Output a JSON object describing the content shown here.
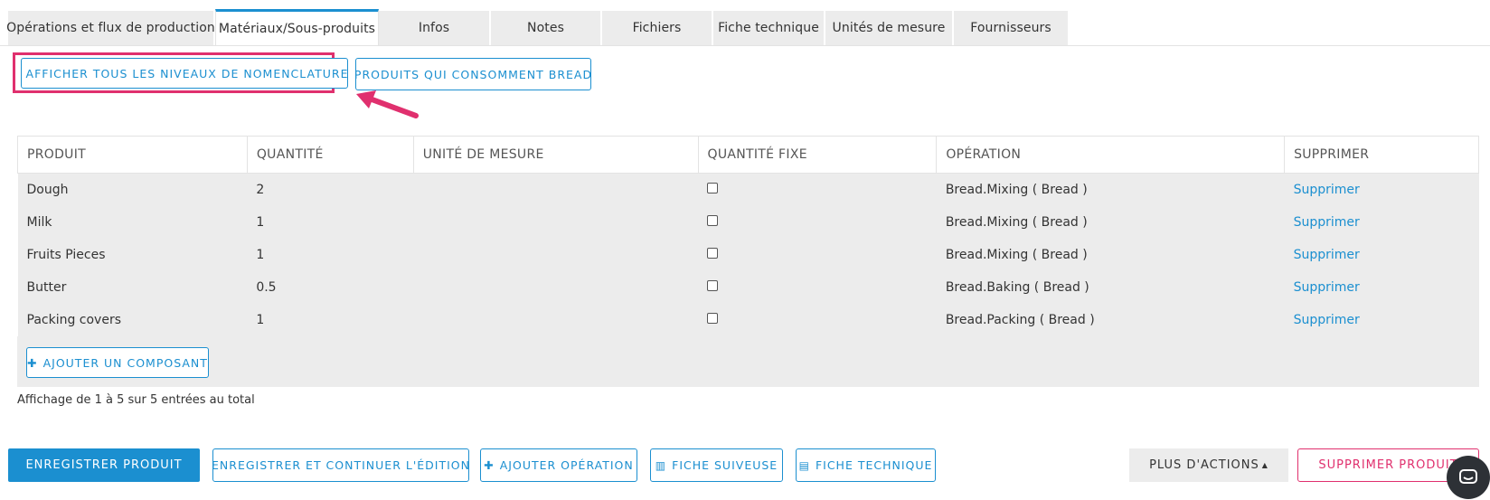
{
  "tabs": [
    {
      "label": "Opérations et flux de production"
    },
    {
      "label": "Matériaux/Sous-produits"
    },
    {
      "label": "Infos"
    },
    {
      "label": "Notes"
    },
    {
      "label": "Fichiers"
    },
    {
      "label": "Fiche technique"
    },
    {
      "label": "Unités de mesure"
    },
    {
      "label": "Fournisseurs"
    }
  ],
  "toolbar": {
    "show_bom_levels": "AFFICHER TOUS LES NIVEAUX DE NOMENCLATURE",
    "consuming_products": "PRODUITS QUI CONSOMMENT BREAD"
  },
  "table": {
    "headers": [
      "PRODUIT",
      "QUANTITÉ",
      "UNITÉ DE MESURE",
      "QUANTITÉ FIXE",
      "OPÉRATION",
      "SUPPRIMER"
    ],
    "rows": [
      {
        "product": "Dough",
        "quantity": "2",
        "unit": "",
        "operation": "Bread.Mixing ( Bread )",
        "delete": "Supprimer"
      },
      {
        "product": "Milk",
        "quantity": "1",
        "unit": "",
        "operation": "Bread.Mixing ( Bread )",
        "delete": "Supprimer"
      },
      {
        "product": "Fruits Pieces",
        "quantity": "1",
        "unit": "",
        "operation": "Bread.Mixing ( Bread )",
        "delete": "Supprimer"
      },
      {
        "product": "Butter",
        "quantity": "0.5",
        "unit": "",
        "operation": "Bread.Baking ( Bread )",
        "delete": "Supprimer"
      },
      {
        "product": "Packing covers",
        "quantity": "1",
        "unit": "",
        "operation": "Bread.Packing ( Bread )",
        "delete": "Supprimer"
      }
    ],
    "add_component": "AJOUTER UN COMPOSANT"
  },
  "pagination_text": "Affichage de 1 à 5 sur 5 entrées au total",
  "actions": {
    "save": "ENREGISTRER PRODUIT",
    "save_continue": "ENREGISTRER ET CONTINUER L'ÉDITION",
    "add_operation": "AJOUTER OPÉRATION",
    "tracking_sheet": "FICHE SUIVEUSE",
    "datasheet": "FICHE TECHNIQUE",
    "more_actions": "PLUS D'ACTIONS",
    "delete_product": "SUPPRIMER PRODUIT"
  },
  "colors": {
    "accent": "#1b8fd0",
    "danger": "#e0306e",
    "panel": "#ececec"
  }
}
